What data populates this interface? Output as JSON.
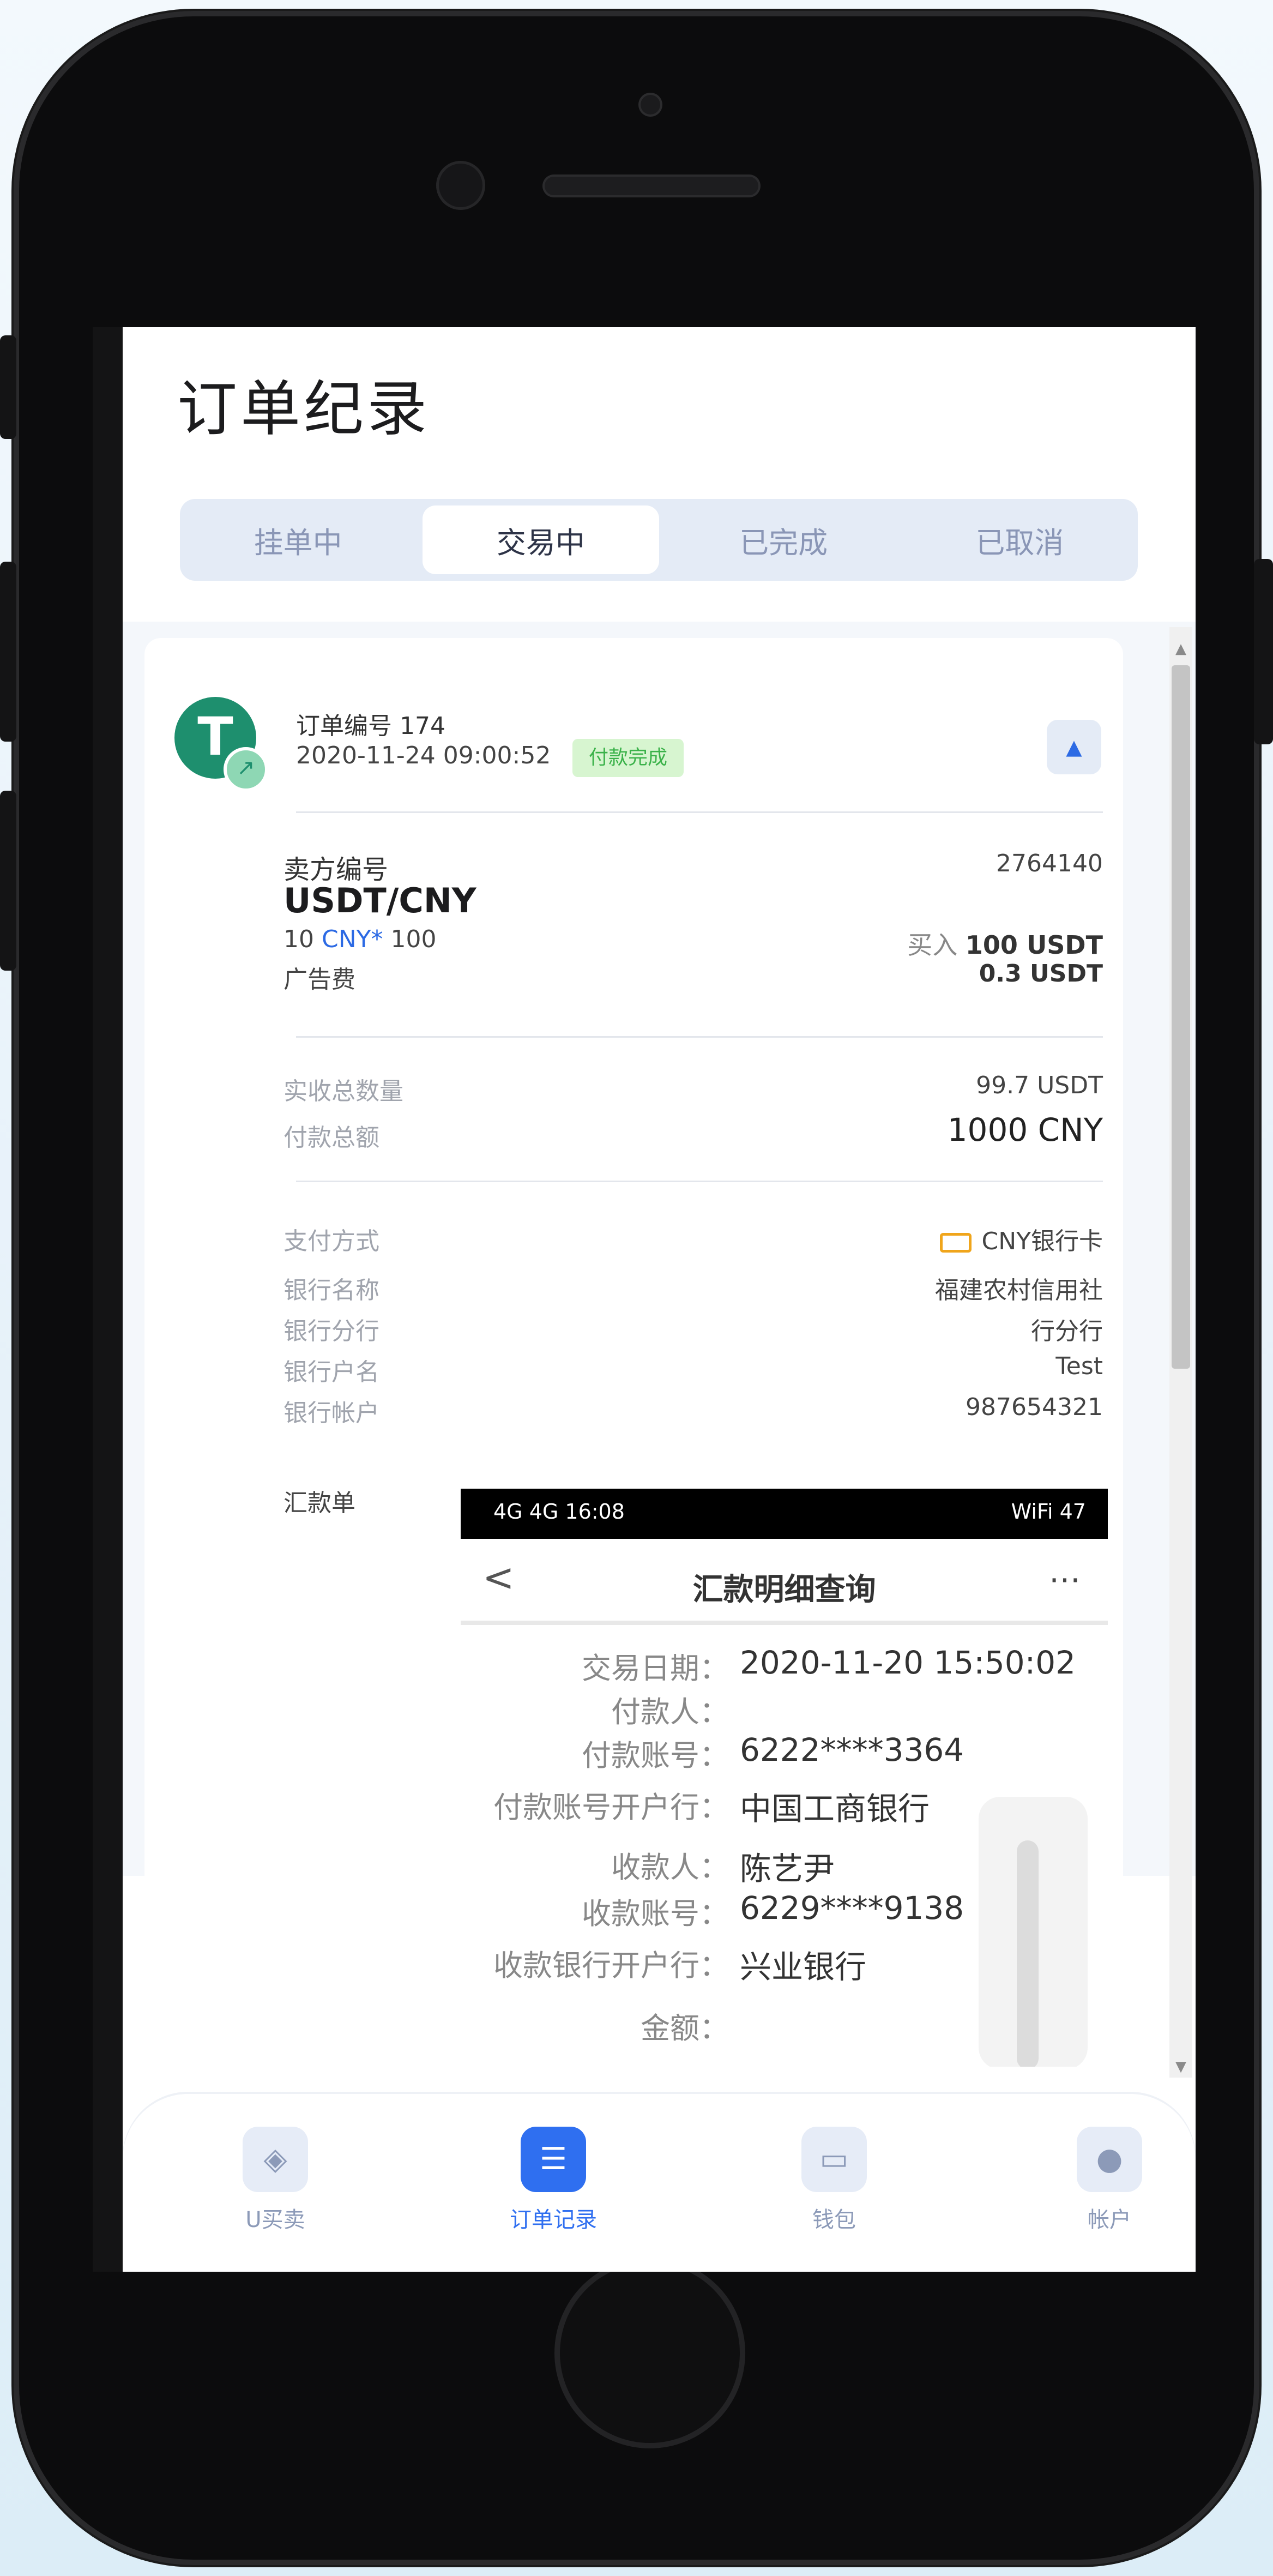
{
  "page_title": "订单纪录",
  "tabs": [
    "挂单中",
    "交易中",
    "已完成",
    "已取消"
  ],
  "order": {
    "coin_icon_text": "T",
    "order_no": "订单编号 174",
    "time": "2020-11-24 09:00:52",
    "status": "付款完成",
    "seller_label": "卖方编号",
    "seller_no": "2764140",
    "pair": "USDT/CNY",
    "rate_prefix": "10 ",
    "rate_currency": "CNY*",
    "rate_suffix": " 100",
    "buy_label": "买入",
    "buy_amount": "100 USDT",
    "fee_label": "广告费",
    "fee_value": "0.3 USDT",
    "received_label": "实收总数量",
    "received_value": "99.7 USDT",
    "paid_label": "付款总额",
    "paid_value": "1000 CNY",
    "pay_method_label": "支付方式",
    "pay_method_value": "CNY银行卡",
    "bank_name_label": "银行名称",
    "bank_name_value": "福建农村信用社",
    "bank_branch_label": "银行分行",
    "bank_branch_value": "行分行",
    "account_name_label": "银行户名",
    "account_name_value": "Test",
    "account_no_label": "银行帐户",
    "account_no_value": "987654321",
    "remit_label": "汇款单"
  },
  "receipt": {
    "status_left": "4G 4G  16:08",
    "status_right": "WiFi 47",
    "title": "汇款明细查询",
    "back": "<",
    "more": "⋯",
    "rows": [
      {
        "k": "交易日期：",
        "v": "2020-11-20 15:50:02"
      },
      {
        "k": "付款人：",
        "v": ""
      },
      {
        "k": "付款账号：",
        "v": "6222****3364"
      },
      {
        "k": "付款账号开户行：",
        "v": "中国工商银行"
      },
      {
        "k": "收款人：",
        "v": "陈艺尹"
      },
      {
        "k": "收款账号：",
        "v": "6229****9138"
      },
      {
        "k": "收款银行开户行：",
        "v": "兴业银行"
      },
      {
        "k": "金额：",
        "v": ""
      }
    ]
  },
  "nav": [
    {
      "label": "U买卖",
      "icon": "diamond-icon"
    },
    {
      "label": "订单记录",
      "icon": "list-icon"
    },
    {
      "label": "钱包",
      "icon": "wallet-icon"
    },
    {
      "label": "帐户",
      "icon": "user-icon"
    }
  ],
  "colors": {
    "accent": "#2f6ff0",
    "status_green": "#3bb24a",
    "coin_green": "#1e8f6e"
  }
}
